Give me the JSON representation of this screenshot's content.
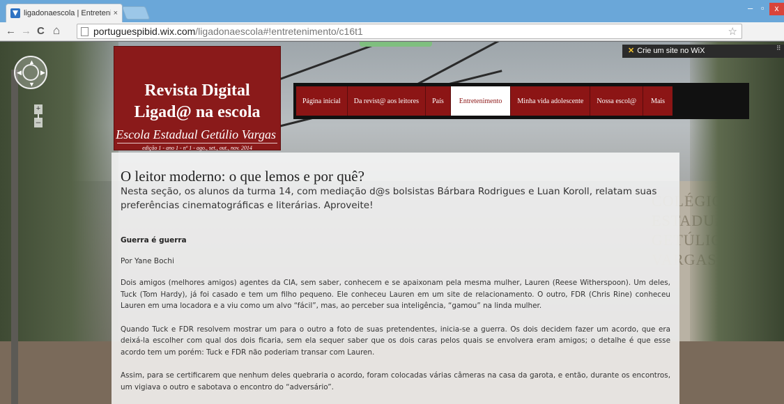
{
  "browser": {
    "tab_title": "ligadonaescola | Entreteni",
    "tab_close": "×",
    "url_host": "portuguespibid.wix.com",
    "url_path": "/ligadonaescola#!entretenimento/c16t1",
    "back": "←",
    "forward": "→",
    "reload": "C",
    "home": "⌂",
    "star": "☆",
    "min": "–",
    "max": "▫",
    "close": "x"
  },
  "wix_banner": {
    "icon": "✕",
    "text": "Crie um site no WiX"
  },
  "header": {
    "title_line1": "Revista Digital",
    "title_line2": "Ligad@ na escola",
    "school": "Escola Estadual Getúlio Vargas",
    "edition": "edição 1 - ano 1 - nº 1 - ago., set., out., nov. 2014"
  },
  "nav": {
    "items": [
      {
        "label": "Página inicial"
      },
      {
        "label": "Da revist@ aos leitores"
      },
      {
        "label": "País"
      },
      {
        "label": "Entretenimento"
      },
      {
        "label": "Minha vida adolescente"
      },
      {
        "label": "Nossa escol@"
      },
      {
        "label": "Mais"
      }
    ],
    "active_index": 3
  },
  "streetview": {
    "zoom_in": "+",
    "zoom_out": "–"
  },
  "background_sign": {
    "line1": "COLÉGIO ESTADUAL",
    "line2": "GETÚLIO VARGAS"
  },
  "article": {
    "title": "O leitor moderno: o que lemos e por quê?",
    "intro": "Nesta seção,  os alunos da turma 14, com mediação d@s bolsistas Bárbara Rodrigues e Luan Koroll, relatam suas preferências cinematográficas e literárias. Aproveite!",
    "section_title": "Guerra é guerra",
    "author": "Por Yane Bochi",
    "paragraphs": [
      "Dois amigos (melhores amigos) agentes da CIA, sem saber, conhecem e se apaixonam pela mesma mulher, Lauren (Reese Witherspoon). Um deles, Tuck (Tom Hardy), já foi casado e tem um filho pequeno. Ele conheceu Lauren em um site de relacionamento. O outro, FDR (Chris Rine) conheceu Lauren em uma locadora e a viu como um alvo “fácil”, mas, ao perceber sua inteligência, “gamou” na linda mulher.",
      "Quando Tuck e FDR resolvem mostrar um para o outro a foto de suas pretendentes, inicia-se a guerra. Os dois decidem fazer um acordo, que era deixá-la escolher com qual dos dois ficaria, sem ela sequer saber que os dois caras pelos quais se envolvera eram amigos; o detalhe é que esse acordo tem um porém: Tuck e FDR não poderiam transar com Lauren.",
      "Assim, para se certificarem que nenhum deles quebraria o acordo, foram colocadas várias câmeras na casa da garota, e então, durante os encontros, um vigiava o outro e sabotava o encontro do “adversário”."
    ]
  },
  "colors": {
    "brand_red": "#8a1a1a",
    "nav_bg": "#111111",
    "active_nav_text": "#8c1515"
  }
}
